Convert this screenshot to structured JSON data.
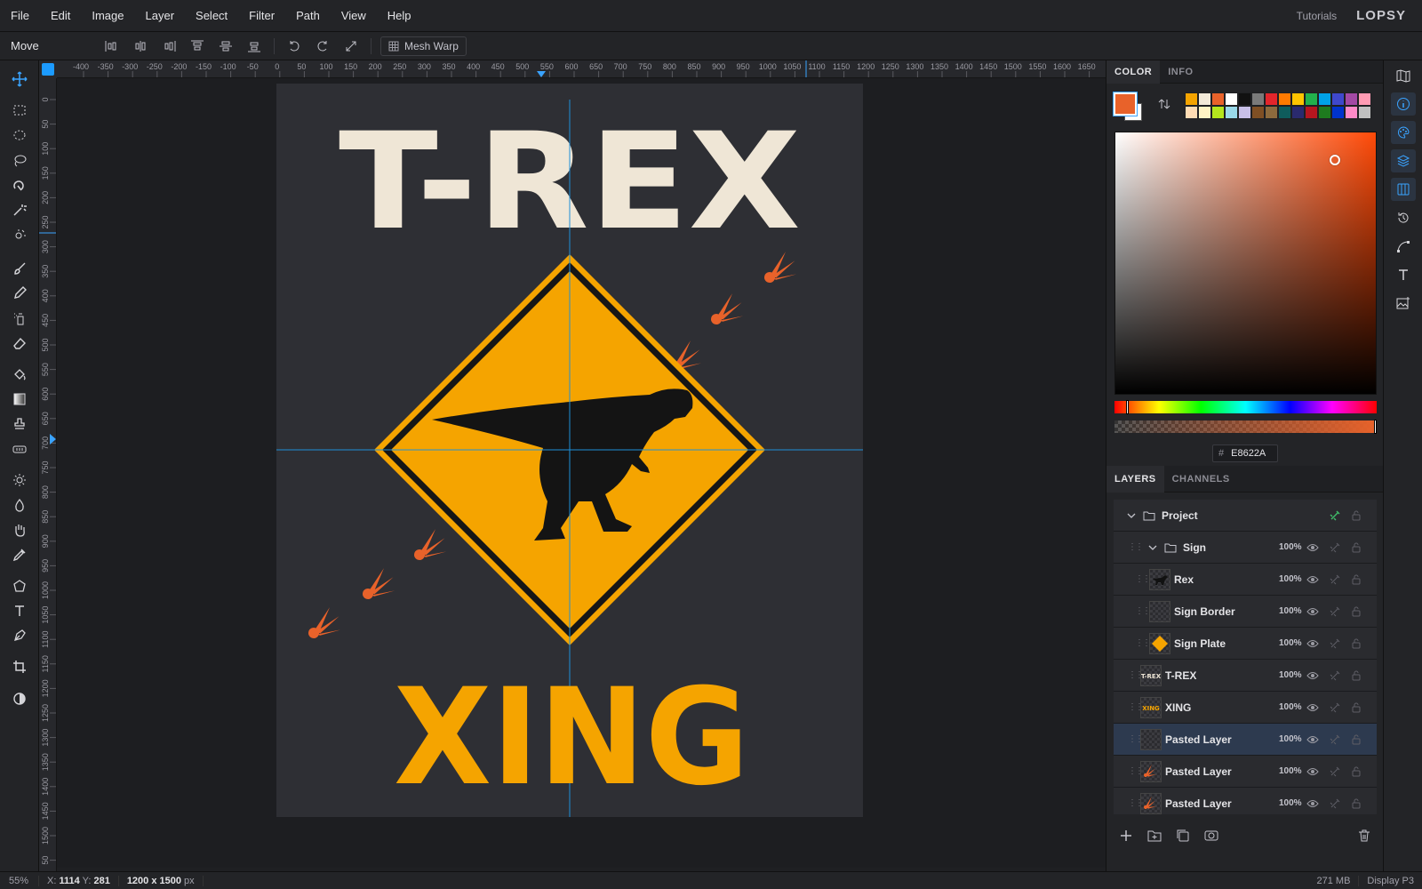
{
  "menu": [
    "File",
    "Edit",
    "Image",
    "Layer",
    "Select",
    "Filter",
    "Path",
    "View",
    "Help"
  ],
  "header": {
    "tutorials": "Tutorials",
    "logo": "LOPSY"
  },
  "toolbar": {
    "tool_name": "Move",
    "mesh_warp": "Mesh Warp"
  },
  "rulers": {
    "h_ticks": [
      "-400",
      "-350",
      "-300",
      "-250",
      "-200",
      "-150",
      "-100",
      "-50",
      "0",
      "50",
      "100",
      "150",
      "200",
      "250",
      "300",
      "350",
      "400",
      "450",
      "500",
      "550",
      "600",
      "650",
      "700",
      "750",
      "800",
      "850",
      "900",
      "950",
      "1000",
      "1050",
      "1100",
      "1150",
      "1200",
      "1250",
      "1300",
      "1350",
      "1400",
      "1450",
      "1500",
      "1550",
      "1600",
      "1650"
    ],
    "v_ticks": [
      "0",
      "50",
      "100",
      "150",
      "200",
      "250",
      "300",
      "350",
      "400",
      "450",
      "500",
      "550",
      "600",
      "650",
      "700",
      "750",
      "800",
      "850",
      "900",
      "950",
      "1000",
      "1050",
      "1100",
      "1150",
      "1200",
      "1250",
      "1300",
      "1350",
      "1400",
      "1450",
      "1500",
      "50"
    ]
  },
  "artwork": {
    "title": "T-REX",
    "subtitle": "XING"
  },
  "color_panel": {
    "tabs": [
      "COLOR",
      "INFO"
    ],
    "hex_label": "#",
    "hex": "E8622A",
    "palette": [
      "#f5a400",
      "#f2e9d8",
      "#e8622a",
      "#ffffff",
      "#111111",
      "#7a7a7a",
      "#e3252b",
      "#ff7a00",
      "#ffc400",
      "#22b14c",
      "#00a2e8",
      "#3f48cc",
      "#a349a4",
      "#ff9bb3",
      "#ffdcb4",
      "#fff3c4",
      "#b5e61d",
      "#99d9ea",
      "#c8bfe7",
      "#7f4f24",
      "#8c6a3d",
      "#0f5c5c",
      "#2a2a6e",
      "#b5161f",
      "#1e7a1e",
      "#0033cc",
      "#ff8ac8",
      "#c0c0c0"
    ]
  },
  "layers_panel": {
    "tabs": [
      "LAYERS",
      "CHANNELS"
    ],
    "layers": [
      {
        "name": "Project",
        "opacity": "",
        "kind": "group",
        "depth": 0
      },
      {
        "name": "Sign",
        "opacity": "100%",
        "kind": "group",
        "depth": 1
      },
      {
        "name": "Rex",
        "opacity": "100%",
        "kind": "layer",
        "depth": 2
      },
      {
        "name": "Sign Border",
        "opacity": "100%",
        "kind": "layer",
        "depth": 2
      },
      {
        "name": "Sign Plate",
        "opacity": "100%",
        "kind": "layer",
        "depth": 2
      },
      {
        "name": "T-REX",
        "opacity": "100%",
        "kind": "layer",
        "depth": 1
      },
      {
        "name": "XING",
        "opacity": "100%",
        "kind": "layer",
        "depth": 1
      },
      {
        "name": "Pasted Layer",
        "opacity": "100%",
        "kind": "layer",
        "depth": 1,
        "selected": true
      },
      {
        "name": "Pasted Layer",
        "opacity": "100%",
        "kind": "layer",
        "depth": 1
      },
      {
        "name": "Pasted Layer",
        "opacity": "100%",
        "kind": "layer",
        "depth": 1
      }
    ]
  },
  "status": {
    "zoom": "55%",
    "x_label": "X:",
    "x": "1114",
    "y_label": "Y:",
    "y": "281",
    "doc_size": "1200 x 1500",
    "doc_unit": "px",
    "memory": "271 MB",
    "profile": "Display P3"
  }
}
